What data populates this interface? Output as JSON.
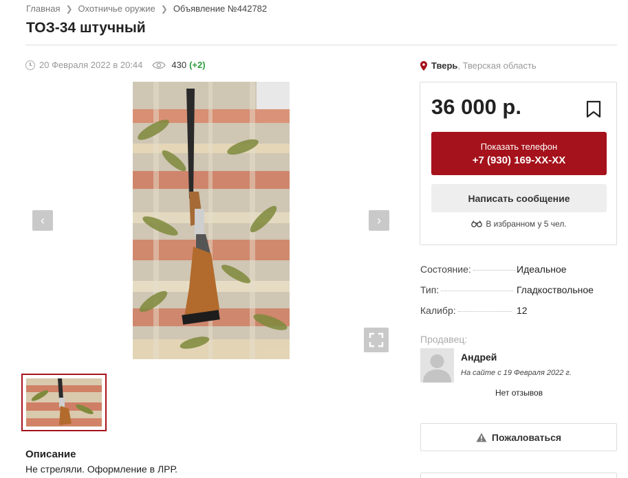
{
  "breadcrumb": {
    "items": [
      "Главная",
      "Охотничье оружие",
      "Объявление №442782"
    ]
  },
  "title": "ТОЗ-34 штучный",
  "meta": {
    "date": "20 Февраля 2022 в 20:44",
    "views": "430",
    "views_delta": "(+2)"
  },
  "location": {
    "city": "Тверь",
    "region": ", Тверская область"
  },
  "price_card": {
    "price": "36 000 р.",
    "phone_label": "Показать телефон",
    "phone_number": "+7 (930) 169-XX-XX",
    "message_label": "Написать сообщение",
    "favorites_text": "В избранном у 5 чел."
  },
  "properties": [
    {
      "key": "Состояние:",
      "value": "Идеальное"
    },
    {
      "key": "Тип:",
      "value": "Гладкоствольное"
    },
    {
      "key": "Калибр:",
      "value": "12"
    }
  ],
  "seller": {
    "label": "Продавец:",
    "name": "Андрей",
    "since": "На сайте с 19 Февраля 2022 г.",
    "reviews": "Нет отзывов"
  },
  "report_label": "Пожаловаться",
  "description": {
    "title": "Описание",
    "text": "Не стреляли. Оформление в ЛРР."
  },
  "colors": {
    "accent": "#a5121b",
    "views_delta": "#2a9d3c"
  },
  "icons": [
    "chevron-right-icon",
    "clock-icon",
    "eye-icon",
    "map-pin-icon",
    "bookmark-icon",
    "binoculars-icon",
    "warning-icon",
    "fullscreen-icon",
    "arrow-left-icon",
    "arrow-right-icon"
  ]
}
